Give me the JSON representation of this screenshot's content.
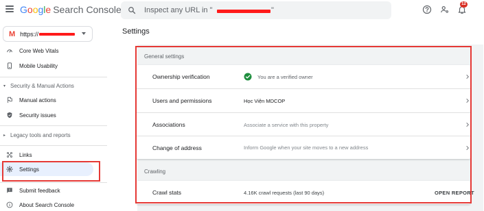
{
  "header": {
    "logo_letters": [
      "G",
      "o",
      "o",
      "g",
      "l",
      "e"
    ],
    "product": "Search Console",
    "search_placeholder": "Inspect any URL in \"",
    "notification_count": "12"
  },
  "sidebar": {
    "property_initial": "M",
    "property_url": "https://",
    "items": [
      {
        "label": "Core Web Vitals",
        "icon": "speedometer-icon"
      },
      {
        "label": "Mobile Usability",
        "icon": "phone-icon"
      }
    ],
    "section_security": "Security & Manual Actions",
    "security_items": [
      {
        "label": "Manual actions",
        "icon": "flag-icon"
      },
      {
        "label": "Security issues",
        "icon": "shield-icon"
      }
    ],
    "section_legacy": "Legacy tools and reports",
    "bottom_items": [
      {
        "label": "Links",
        "icon": "links-icon"
      },
      {
        "label": "Settings",
        "icon": "gear-icon"
      },
      {
        "label": "Submit feedback",
        "icon": "feedback-icon"
      },
      {
        "label": "About Search Console",
        "icon": "info-icon"
      }
    ]
  },
  "main": {
    "title": "Settings",
    "general_label": "General settings",
    "general_rows": [
      {
        "label": "Ownership verification",
        "value": "You are a verified owner"
      },
      {
        "label": "Users and permissions",
        "value": "Học Viện MDCOP"
      },
      {
        "label": "Associations",
        "value": "Associate a service with this property"
      },
      {
        "label": "Change of address",
        "value": "Inform Google when your site moves to a new address"
      }
    ],
    "crawling_label": "Crawling",
    "crawl_row": {
      "label": "Crawl stats",
      "value": "4.16K crawl requests (last 90 days)",
      "action": "OPEN REPORT"
    }
  },
  "colors": {
    "accent_blue": "#1a73e8",
    "verified_green": "#1e8e3e",
    "annotation_red": "#e53935",
    "active_nav": "#e8f0fe"
  }
}
